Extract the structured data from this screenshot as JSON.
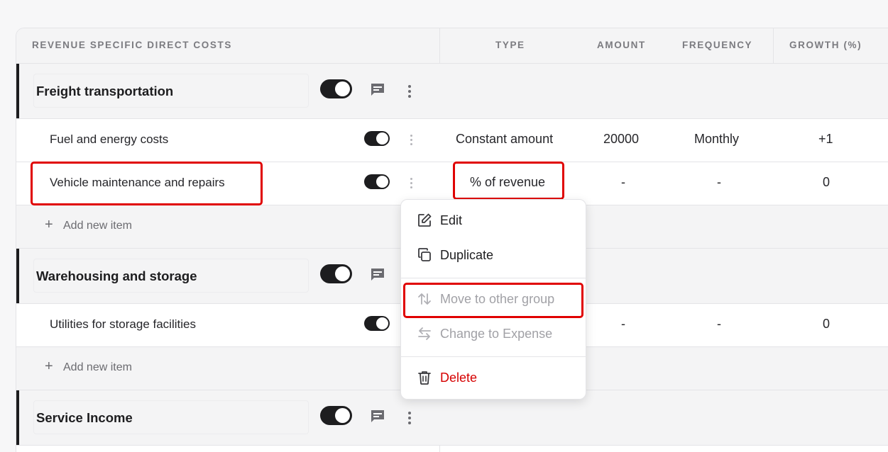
{
  "header": {
    "section_title": "REVENUE SPECIFIC DIRECT COSTS",
    "col_type": "TYPE",
    "col_amount": "AMOUNT",
    "col_frequency": "FREQUENCY",
    "col_growth": "GROWTH (%)"
  },
  "groups": [
    {
      "name": "Freight transportation",
      "enabled": true,
      "items": [
        {
          "name": "Fuel and energy costs",
          "enabled": true,
          "type": "Constant amount",
          "amount": "20000",
          "frequency": "Monthly",
          "growth": "+1"
        },
        {
          "name": "Vehicle maintenance and repairs",
          "enabled": true,
          "type": "% of revenue",
          "amount": "-",
          "frequency": "-",
          "growth": "0"
        }
      ],
      "add_label": "Add new item"
    },
    {
      "name": "Warehousing and storage",
      "enabled": true,
      "items": [
        {
          "name": "Utilities for storage facilities",
          "enabled": true,
          "type": "",
          "amount": "-",
          "frequency": "-",
          "growth": "0"
        }
      ],
      "add_label": "Add new item"
    },
    {
      "name": "Service Income",
      "enabled": true,
      "items": []
    }
  ],
  "context_menu": {
    "edit": "Edit",
    "duplicate": "Duplicate",
    "move": "Move to other group",
    "change": "Change to Expense",
    "delete": "Delete"
  },
  "colors": {
    "highlight": "#e00000",
    "danger": "#d60000",
    "toggle_on": "#1d1d1f"
  },
  "icons": [
    "comment-icon",
    "more-vertical-icon",
    "plus-icon",
    "edit-icon",
    "duplicate-icon",
    "move-icon",
    "swap-icon",
    "trash-icon"
  ]
}
